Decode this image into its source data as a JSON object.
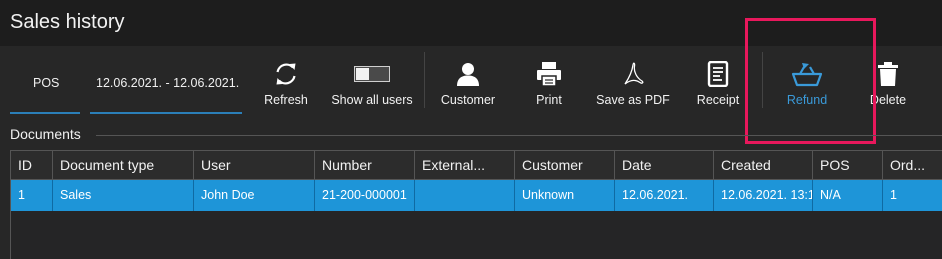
{
  "window": {
    "title": "Sales history"
  },
  "filters": {
    "pos": "POS",
    "date_range": "12.06.2021. - 12.06.2021."
  },
  "toolbar": {
    "refresh": "Refresh",
    "show_all_users": "Show all users",
    "customer": "Customer",
    "print": "Print",
    "save_as_pdf": "Save as PDF",
    "receipt": "Receipt",
    "refund": "Refund",
    "delete": "Delete"
  },
  "colors": {
    "accent": "#3a9ad9",
    "selected_row": "#1e95d8",
    "highlight_box": "#e8185c"
  },
  "documents": {
    "label": "Documents",
    "columns": [
      "ID",
      "Document type",
      "User",
      "Number",
      "External...",
      "Customer",
      "Date",
      "Created",
      "POS",
      "Ord..."
    ],
    "rows": [
      [
        "1",
        "Sales",
        "John Doe",
        "21-200-000001",
        "",
        "Unknown",
        "12.06.2021.",
        "12.06.2021. 13:1",
        "N/A",
        "1"
      ]
    ]
  }
}
